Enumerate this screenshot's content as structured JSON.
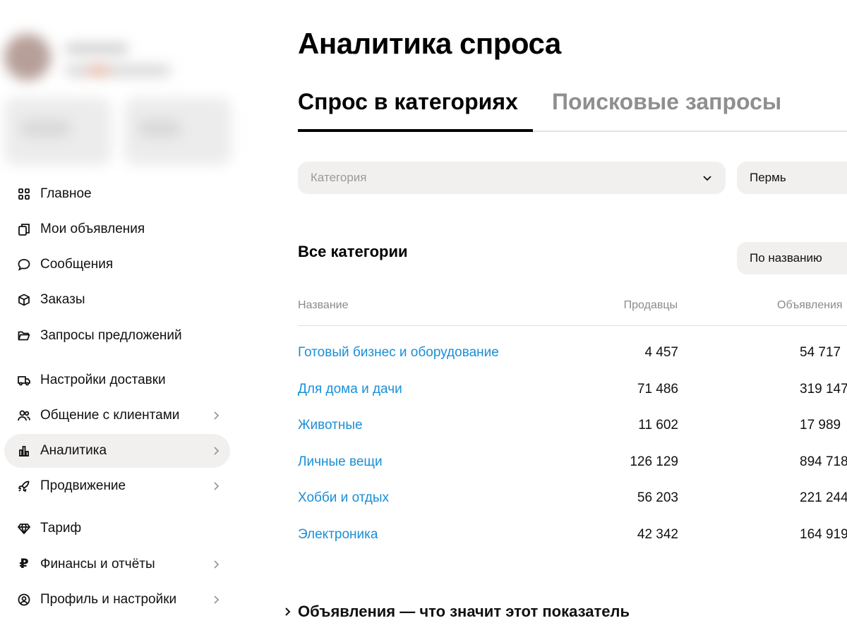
{
  "sidebar": {
    "nav": [
      {
        "label": "Главное",
        "icon": "grid-icon",
        "chevron": false,
        "active": false
      },
      {
        "label": "Мои объявления",
        "icon": "copy-icon",
        "chevron": false,
        "active": false
      },
      {
        "label": "Сообщения",
        "icon": "chat-bubble-icon",
        "chevron": false,
        "active": false
      },
      {
        "label": "Заказы",
        "icon": "box-icon",
        "chevron": false,
        "active": false
      },
      {
        "label": "Запросы предложений",
        "icon": "folder-open-icon",
        "chevron": false,
        "active": false
      },
      {
        "label": "Настройки доставки",
        "icon": "truck-icon",
        "chevron": false,
        "active": false
      },
      {
        "label": "Общение с клиентами",
        "icon": "users-icon",
        "chevron": true,
        "active": false
      },
      {
        "label": "Аналитика",
        "icon": "bar-chart-icon",
        "chevron": true,
        "active": true
      },
      {
        "label": "Продвижение",
        "icon": "rocket-icon",
        "chevron": true,
        "active": false
      },
      {
        "label": "Тариф",
        "icon": "diamond-icon",
        "chevron": false,
        "active": false
      },
      {
        "label": "Финансы и отчёты",
        "icon": "ruble-icon",
        "chevron": true,
        "active": false
      },
      {
        "label": "Профиль и настройки",
        "icon": "user-circle-icon",
        "chevron": true,
        "active": false
      }
    ]
  },
  "main": {
    "title": "Аналитика спроса",
    "tabs": [
      {
        "label": "Спрос в категориях",
        "active": true
      },
      {
        "label": "Поисковые запросы",
        "active": false
      }
    ],
    "filters": {
      "category_placeholder": "Категория",
      "city_value": "Пермь"
    },
    "section_title": "Все категории",
    "sort_value": "По названию",
    "table": {
      "headers": {
        "name": "Название",
        "sellers": "Продавцы",
        "ads": "Объявления"
      },
      "rows": [
        {
          "name": "Готовый бизнес и оборудование",
          "sellers": "4 457",
          "ads": "54 717"
        },
        {
          "name": "Для дома и дачи",
          "sellers": "71 486",
          "ads": "319 147"
        },
        {
          "name": "Животные",
          "sellers": "11 602",
          "ads": "17 989"
        },
        {
          "name": "Личные вещи",
          "sellers": "126 129",
          "ads": "894 718"
        },
        {
          "name": "Хобби и отдых",
          "sellers": "56 203",
          "ads": "221 244"
        },
        {
          "name": "Электроника",
          "sellers": "42 342",
          "ads": "164 919"
        }
      ]
    },
    "faq_label": "Объявления — что значит этот показатель"
  },
  "colors": {
    "link": "#1a8fd6",
    "muted": "#8f8f8f",
    "chip_bg": "#f1f0ef",
    "active_tab": "#000000"
  }
}
